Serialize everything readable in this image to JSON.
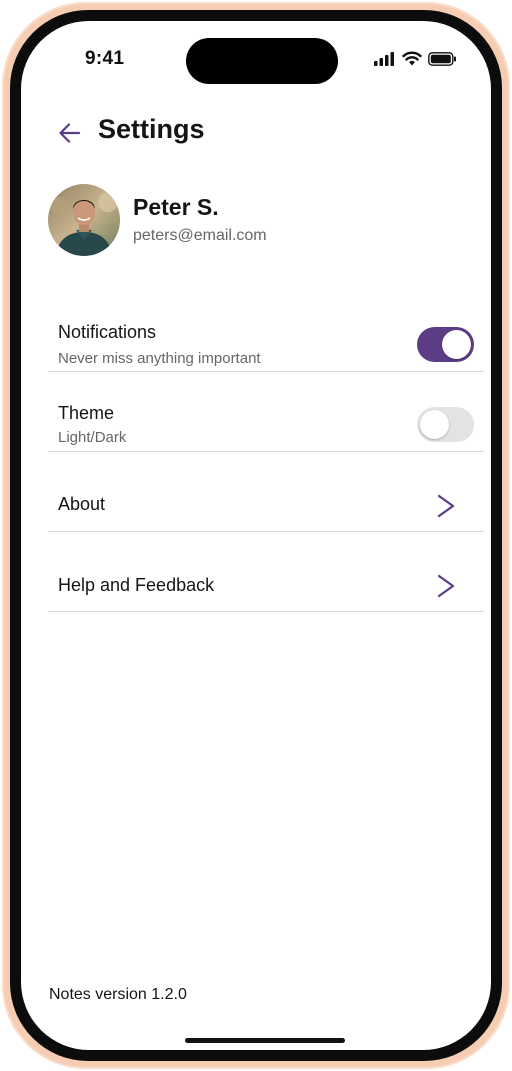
{
  "status_bar": {
    "time": "9:41",
    "signal_icon": "cellular-signal-icon",
    "wifi_icon": "wifi-icon",
    "battery_icon": "battery-icon"
  },
  "header": {
    "back_icon": "back-arrow-icon",
    "title": "Settings"
  },
  "profile": {
    "avatar_icon": "avatar-photo",
    "name": "Peter S.",
    "email": "peters@email.com"
  },
  "settings": [
    {
      "title": "Notifications",
      "subtitle": "Never miss anything important",
      "control": "toggle",
      "enabled": true
    },
    {
      "title": "Theme",
      "subtitle": "Light/Dark",
      "control": "toggle",
      "enabled": false
    },
    {
      "title": "About",
      "control": "chevron",
      "icon": "chevron-right-icon"
    },
    {
      "title": "Help and Feedback",
      "control": "chevron",
      "icon": "chevron-right-icon"
    }
  ],
  "footer": {
    "version": "Notes version 1.2.0"
  },
  "colors": {
    "accent": "#5b3d86",
    "toggle_off": "#e3e3e3",
    "phone_frame": "#f6cdb3",
    "bezel": "#0c0c0c",
    "divider": "#d9d9d9"
  }
}
